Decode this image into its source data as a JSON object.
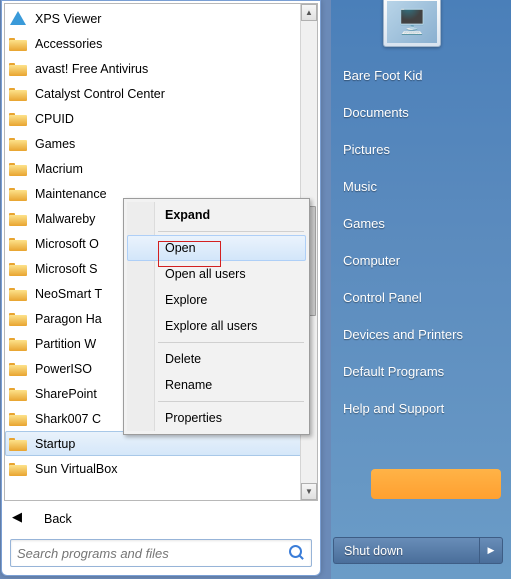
{
  "programs": [
    {
      "label": "XPS Viewer",
      "icon": "xps"
    },
    {
      "label": "Accessories",
      "icon": "folder"
    },
    {
      "label": "avast! Free Antivirus",
      "icon": "folder"
    },
    {
      "label": "Catalyst Control Center",
      "icon": "folder"
    },
    {
      "label": "CPUID",
      "icon": "folder"
    },
    {
      "label": "Games",
      "icon": "folder"
    },
    {
      "label": "Macrium",
      "icon": "folder"
    },
    {
      "label": "Maintenance",
      "icon": "folder"
    },
    {
      "label": "Malwareby",
      "icon": "folder"
    },
    {
      "label": "Microsoft O",
      "icon": "folder"
    },
    {
      "label": "Microsoft S",
      "icon": "folder"
    },
    {
      "label": "NeoSmart T",
      "icon": "folder"
    },
    {
      "label": "Paragon Ha",
      "icon": "folder"
    },
    {
      "label": "Partition W",
      "icon": "folder"
    },
    {
      "label": "PowerISO",
      "icon": "folder"
    },
    {
      "label": "SharePoint",
      "icon": "folder"
    },
    {
      "label": "Shark007 C",
      "icon": "folder"
    },
    {
      "label": "Startup",
      "icon": "folder",
      "selected": true
    },
    {
      "label": "Sun VirtualBox",
      "icon": "folder"
    }
  ],
  "back_label": "Back",
  "search": {
    "placeholder": "Search programs and files"
  },
  "right_links": {
    "user": "Bare Foot Kid",
    "documents": "Documents",
    "pictures": "Pictures",
    "music": "Music",
    "games": "Games",
    "computer": "Computer",
    "control_panel": "Control Panel",
    "devices": "Devices and Printers",
    "default_programs": "Default Programs",
    "help": "Help and Support"
  },
  "shutdown": {
    "label": "Shut down"
  },
  "context": {
    "expand": "Expand",
    "open": "Open",
    "open_all": "Open all users",
    "explore": "Explore",
    "explore_all": "Explore all users",
    "delete": "Delete",
    "rename": "Rename",
    "properties": "Properties"
  }
}
